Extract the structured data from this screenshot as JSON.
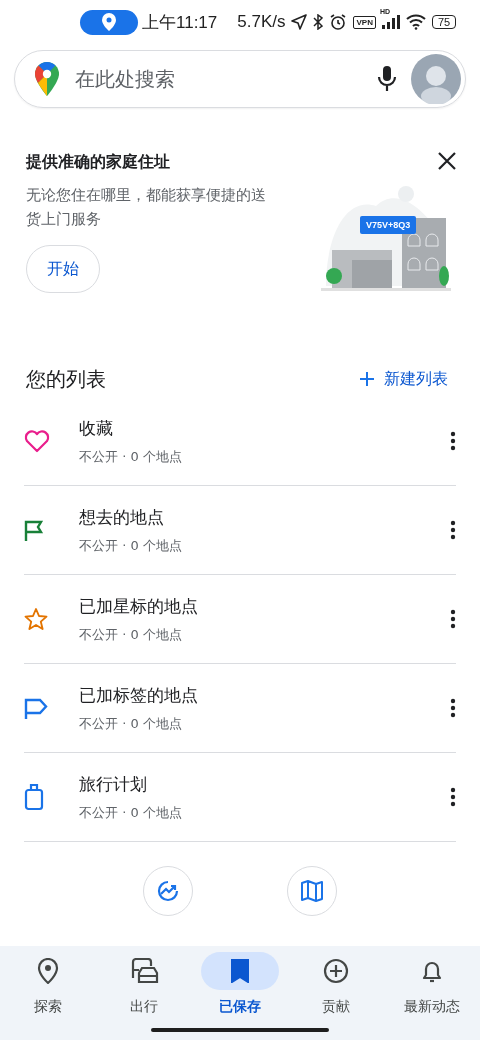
{
  "status_bar": {
    "time": "上午11:17",
    "speed": "5.7K/s",
    "vpn": "VPN",
    "hd": "HD",
    "battery": "75"
  },
  "search": {
    "placeholder": "在此处搜索"
  },
  "home_card": {
    "title": "提供准确的家庭住址",
    "text": "无论您住在哪里，都能获享便捷的送货上门服务",
    "button": "开始",
    "plus_code": "V75V+8Q3"
  },
  "lists_header": {
    "title": "您的列表",
    "new_list": "新建列表"
  },
  "lists": [
    {
      "kind": "heart",
      "color": "#e91e8c",
      "name": "收藏",
      "meta": "不公开 · 0 个地点"
    },
    {
      "kind": "flag",
      "color": "#188038",
      "name": "想去的地点",
      "meta": "不公开 · 0 个地点"
    },
    {
      "kind": "star",
      "color": "#e37400",
      "name": "已加星标的地点",
      "meta": "不公开 · 0 个地点"
    },
    {
      "kind": "label",
      "color": "#1a73e8",
      "name": "已加标签的地点",
      "meta": "不公开 · 0 个地点"
    },
    {
      "kind": "luggage",
      "color": "#1a73e8",
      "name": "旅行计划",
      "meta": "不公开 · 0 个地点"
    }
  ],
  "shortcuts": [
    {
      "kind": "trending"
    },
    {
      "kind": "map"
    }
  ],
  "nav": [
    {
      "kind": "explore",
      "label": "探索",
      "selected": false
    },
    {
      "kind": "go",
      "label": "出行",
      "selected": false
    },
    {
      "kind": "saved",
      "label": "已保存",
      "selected": true
    },
    {
      "kind": "contribute",
      "label": "贡献",
      "selected": false
    },
    {
      "kind": "updates",
      "label": "最新动态",
      "selected": false
    }
  ]
}
